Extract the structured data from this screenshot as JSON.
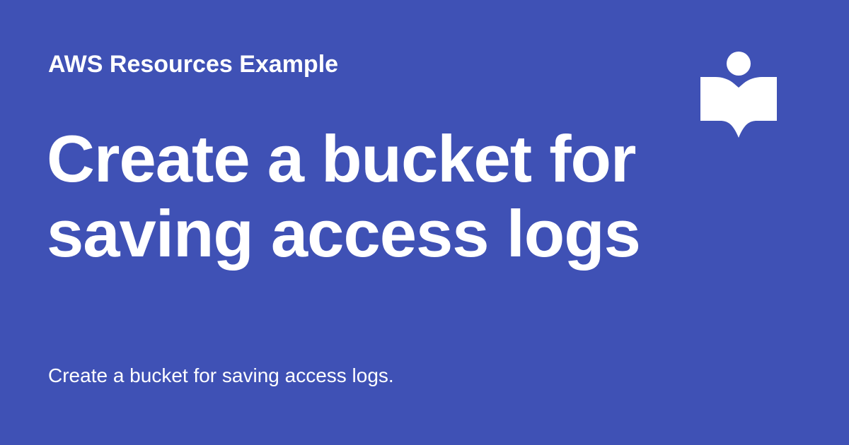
{
  "site": {
    "name": "AWS Resources Example"
  },
  "page": {
    "title": "Create a bucket for saving access logs",
    "description": "Create a bucket for saving access logs."
  },
  "logo": {
    "icon": "reader-book-icon"
  },
  "colors": {
    "background": "#3f51b5",
    "text": "#ffffff"
  }
}
